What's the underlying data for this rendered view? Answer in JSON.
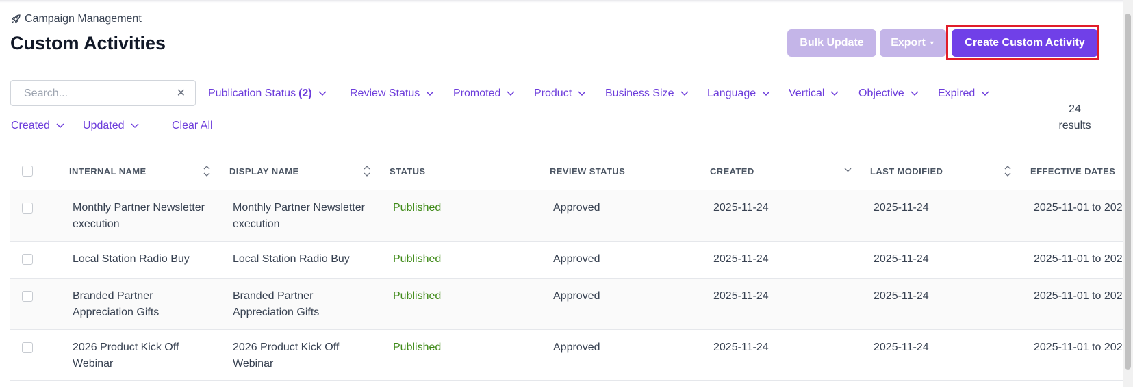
{
  "breadcrumb": {
    "label": "Campaign Management"
  },
  "page": {
    "title": "Custom Activities"
  },
  "actions": {
    "bulk_update": "Bulk Update",
    "export": "Export",
    "create": "Create Custom Activity"
  },
  "search": {
    "placeholder": "Search...",
    "value": ""
  },
  "filters": [
    {
      "label": "Publication Status",
      "count": "(2)"
    },
    {
      "label": "Review Status",
      "count": ""
    },
    {
      "label": "Promoted",
      "count": ""
    },
    {
      "label": "Product",
      "count": ""
    },
    {
      "label": "Business Size",
      "count": ""
    },
    {
      "label": "Language",
      "count": ""
    },
    {
      "label": "Vertical",
      "count": ""
    },
    {
      "label": "Objective",
      "count": ""
    },
    {
      "label": "Expired",
      "count": ""
    },
    {
      "label": "Created",
      "count": ""
    },
    {
      "label": "Updated",
      "count": ""
    }
  ],
  "clear_all": "Clear All",
  "results": {
    "count": "24",
    "label": "results"
  },
  "table": {
    "columns": [
      "INTERNAL NAME",
      "DISPLAY NAME",
      "STATUS",
      "REVIEW STATUS",
      "CREATED",
      "LAST MODIFIED",
      "EFFECTIVE DATES"
    ],
    "rows": [
      {
        "internal_name": "Monthly Partner Newsletter execution",
        "display_name": "Monthly Partner Newsletter execution",
        "status": "Published",
        "review_status": "Approved",
        "created": "2025-11-24",
        "last_modified": "2025-11-24",
        "effective_dates": "2025-11-01 to 202"
      },
      {
        "internal_name": "Local Station Radio Buy",
        "display_name": "Local Station Radio Buy",
        "status": "Published",
        "review_status": "Approved",
        "created": "2025-11-24",
        "last_modified": "2025-11-24",
        "effective_dates": "2025-11-01 to 202"
      },
      {
        "internal_name": "Branded Partner Appreciation Gifts",
        "display_name": "Branded Partner Appreciation Gifts",
        "status": "Published",
        "review_status": "Approved",
        "created": "2025-11-24",
        "last_modified": "2025-11-24",
        "effective_dates": "2025-11-01 to 202"
      },
      {
        "internal_name": "2026 Product Kick Off Webinar",
        "display_name": "2026 Product Kick Off Webinar",
        "status": "Published",
        "review_status": "Approved",
        "created": "2025-11-24",
        "last_modified": "2025-11-24",
        "effective_dates": "2025-11-01 to 202"
      }
    ]
  },
  "colors": {
    "accent": "#7040e8",
    "accent_disabled": "#c4b5e8",
    "link": "#6d3ddb",
    "published": "#3f8a18",
    "highlight": "#e11d2a"
  }
}
